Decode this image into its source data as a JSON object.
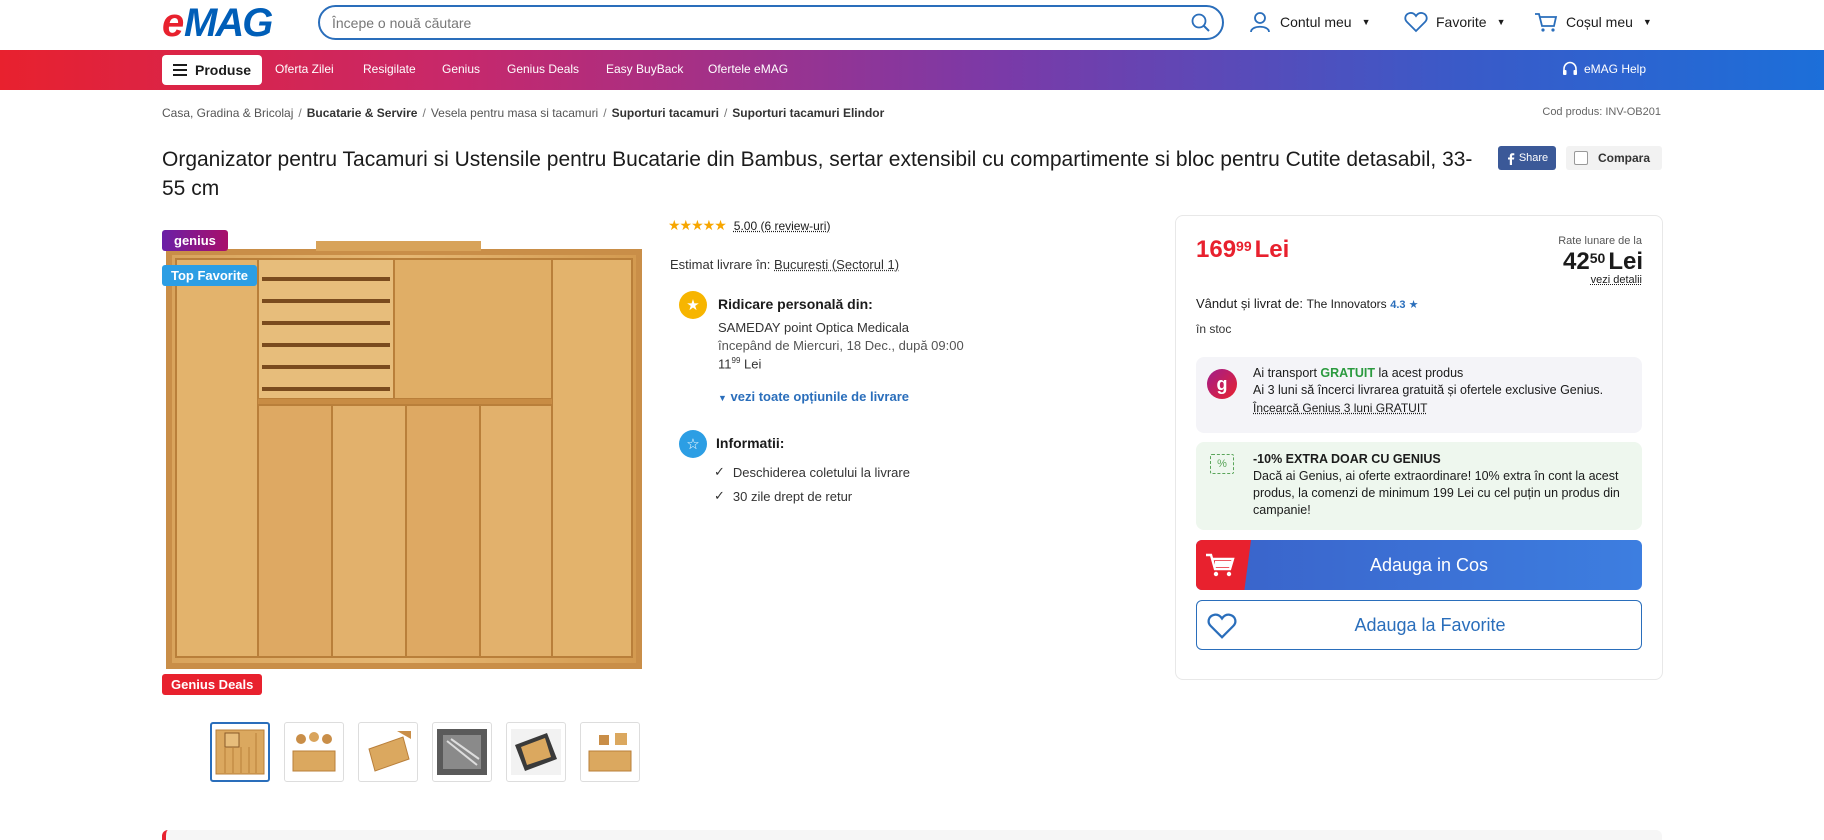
{
  "header": {
    "logo": "eMAG",
    "search": {
      "placeholder": "Începe o nouă căutare"
    },
    "account_label": "Contul meu",
    "favorites_label": "Favorite",
    "cart_label": "Coșul meu"
  },
  "nav": {
    "produse_label": "Produse",
    "items": [
      "Oferta Zilei",
      "Resigilate",
      "Genius",
      "Genius Deals",
      "Easy BuyBack",
      "Ofertele eMAG"
    ],
    "help_label": "eMAG Help"
  },
  "breadcrumb": {
    "items": [
      "Casa, Gradina & Bricolaj",
      "Bucatarie & Servire",
      "Vesela pentru masa si tacamuri",
      "Suporturi tacamuri",
      "Suporturi tacamuri Elindor"
    ],
    "product_code": "Cod produs: INV-OB201"
  },
  "product": {
    "title": "Organizator pentru Tacamuri si Ustensile pentru Bucatarie din Bambus, sertar extensibil cu compartimente si bloc pentru Cutite detasabil, 33-55 cm",
    "share_label": "Share",
    "compare_label": "Compara",
    "badges": {
      "genius": "genius",
      "top": "Top Favorite",
      "deals": "Genius Deals"
    }
  },
  "delivery": {
    "stars": "★★★★★",
    "rating_text": "5.00 (6 review-uri)",
    "estimat_label": "Estimat livrare în:",
    "location": "București (Sectorul 1)",
    "pickup_title": "Ridicare personală din:",
    "pickup_point": "SAMEDAY point Optica Medicala",
    "pickup_date": "începând de Miercuri, 18 Dec., după 09:00",
    "pickup_price_int": "11",
    "pickup_price_dec": "99",
    "pickup_currency": "Lei",
    "see_options": "vezi toate opțiunile de livrare",
    "info_title": "Informatii:",
    "info_items": [
      "Deschiderea coletului la livrare",
      "30 zile drept de retur"
    ]
  },
  "buybox": {
    "price_int": "169",
    "price_dec": "99",
    "currency": "Lei",
    "rate_label": "Rate lunare de la",
    "rate_int": "42",
    "rate_dec": "50",
    "rate_link": "vezi detalii",
    "seller_label": "Vândut și livrat de:",
    "seller_name": "The Innovators",
    "seller_rating": "4.3 ★",
    "stock": "în stoc",
    "genius_line1_prefix": "Ai transport",
    "genius_line1_free": "GRATUIT",
    "genius_line1_suffix": "la acest produs",
    "genius_line2": "Ai 3 luni să încerci livrarea gratuită și ofertele exclusive Genius.",
    "genius_link": "Încearcă Genius 3 luni GRATUIT",
    "extra_icon": "%",
    "extra_title": "-10% EXTRA DOAR CU GENIUS",
    "extra_text": "Dacă ai Genius, ai oferte extraordinare! 10% extra în cont la acest produs, la comenzi de minimum 199 Lei cu cel puțin un produs din campanie!",
    "add_to_cart": "Adauga in Cos",
    "add_to_fav": "Adauga la Favorite"
  },
  "colors": {
    "brand_red": "#e8212e",
    "brand_blue": "#2a6ebb",
    "genius_green": "#2b9a3f"
  }
}
